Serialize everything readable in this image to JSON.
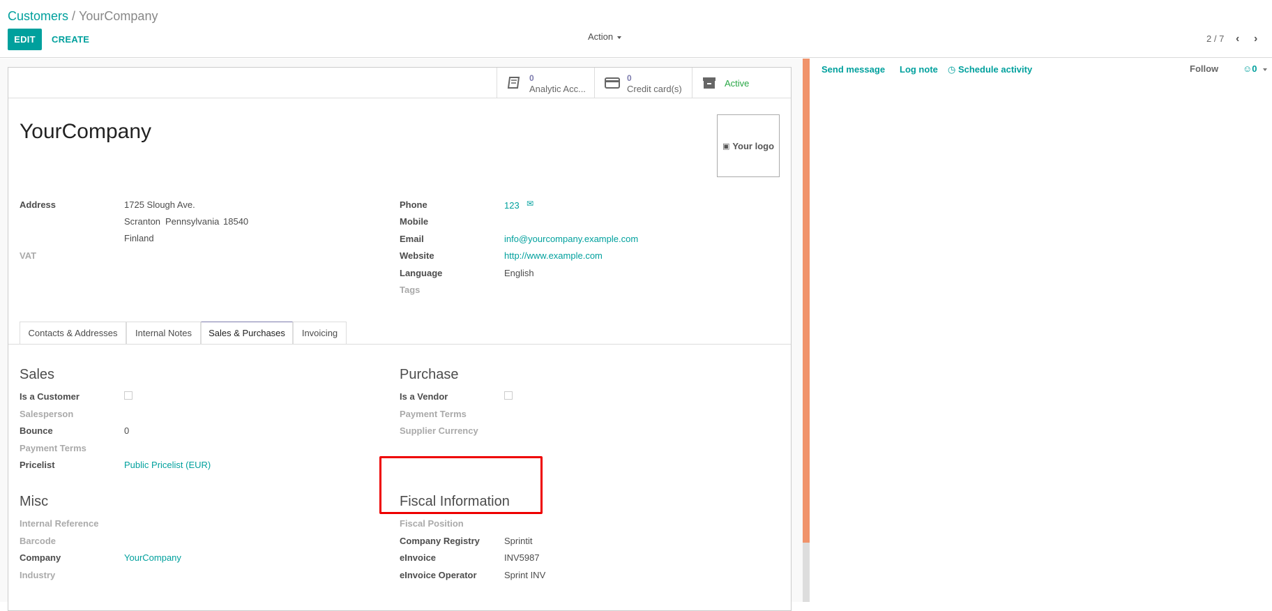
{
  "breadcrumb": {
    "parent": "Customers",
    "separator": "/",
    "current": "YourCompany"
  },
  "toolbar": {
    "edit_label": "EDIT",
    "create_label": "CREATE",
    "action_label": "Action"
  },
  "pager": {
    "value": "2 / 7"
  },
  "stats": [
    {
      "value": "0",
      "label": "Analytic Acc..."
    },
    {
      "value": "0",
      "label": "Credit card(s)"
    },
    {
      "value": "",
      "label": "Active"
    }
  ],
  "partner": {
    "name": "YourCompany",
    "logo_label": "Your logo"
  },
  "fields_left": {
    "address_label": "Address",
    "street": "1725 Slough Ave.",
    "city": "Scranton",
    "state": "Pennsylvania",
    "zip": "18540",
    "country": "Finland",
    "vat_label": "VAT"
  },
  "fields_right": {
    "phone_label": "Phone",
    "phone_value": "123",
    "mobile_label": "Mobile",
    "email_label": "Email",
    "email_value": "info@yourcompany.example.com",
    "website_label": "Website",
    "website_value": "http://www.example.com",
    "language_label": "Language",
    "language_value": "English",
    "tags_label": "Tags"
  },
  "tabs": [
    "Contacts & Addresses",
    "Internal Notes",
    "Sales & Purchases",
    "Invoicing"
  ],
  "sales": {
    "title": "Sales",
    "is_customer_label": "Is a Customer",
    "salesperson_label": "Salesperson",
    "bounce_label": "Bounce",
    "bounce_value": "0",
    "payment_terms_label": "Payment Terms",
    "pricelist_label": "Pricelist",
    "pricelist_value": "Public Pricelist (EUR)"
  },
  "purchase": {
    "title": "Purchase",
    "is_vendor_label": "Is a Vendor",
    "payment_terms_label": "Payment Terms",
    "supplier_currency_label": "Supplier Currency"
  },
  "misc": {
    "title": "Misc",
    "internal_ref_label": "Internal Reference",
    "barcode_label": "Barcode",
    "company_label": "Company",
    "company_value": "YourCompany",
    "industry_label": "Industry"
  },
  "fiscal": {
    "title": "Fiscal Information",
    "fiscal_position_label": "Fiscal Position",
    "company_registry_label": "Company Registry",
    "company_registry_value": "Sprintit",
    "einvoice_label": "eInvoice",
    "einvoice_value": "INV5987",
    "einvoice_operator_label": "eInvoice Operator",
    "einvoice_operator_value": "Sprint INV"
  },
  "chatter": {
    "send_message": "Send message",
    "log_note": "Log note",
    "schedule_activity": "Schedule activity",
    "follow": "Follow",
    "followers_count": "0"
  },
  "colors": {
    "accent": "#00a09d",
    "stat_value": "#7c7bad",
    "active": "#28a745",
    "highlight": "#ee0000",
    "scroll": "#f0936b"
  }
}
